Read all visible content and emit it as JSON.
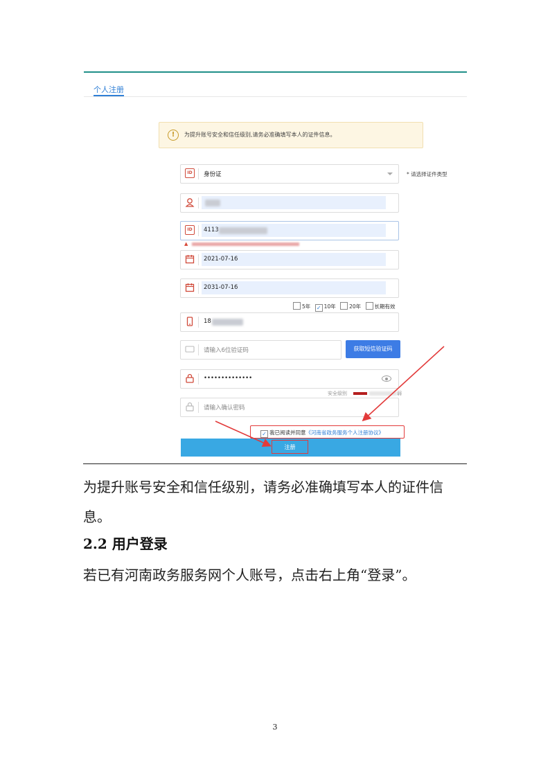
{
  "screenshot": {
    "tab_label": "个人注册",
    "notice": "为提升账号安全和信任级别,请务必准确填写本人的证件信息。",
    "id_type": {
      "value": "身份证",
      "hint": "* 请选择证件类型"
    },
    "id_number_prefix": "4113",
    "start_date": "2021-07-16",
    "end_date": "2031-07-16",
    "validity_options": [
      {
        "label": "5年",
        "checked": false
      },
      {
        "label": "10年",
        "checked": true
      },
      {
        "label": "20年",
        "checked": false
      },
      {
        "label": "长期有效",
        "checked": false
      }
    ],
    "phone_prefix": "18",
    "sms_placeholder": "请输入6位验证码",
    "sms_button": "获取短信验证码",
    "password_mask": "••••••••••••••",
    "strength_label": "安全级别",
    "strength_suffix": "弱",
    "confirm_placeholder": "请输入确认密码",
    "agree_text": "我已阅读并同意",
    "agree_link": "《河南省政务服务个人注册协议》",
    "register_button": "注册",
    "colors": {
      "accent": "#3d7ce5",
      "register_bar": "#39a8e3",
      "highlight": "#e23a3a"
    }
  },
  "document": {
    "paragraph_1_line_1": "为提升账号安全和信任级别，请务必准确填写本人的证件信",
    "paragraph_1_line_2": "息。",
    "heading": "2.2 用户登录",
    "paragraph_2": "若已有河南政务服务网个人账号，点击右上角“登录”。",
    "page_number": "3"
  }
}
